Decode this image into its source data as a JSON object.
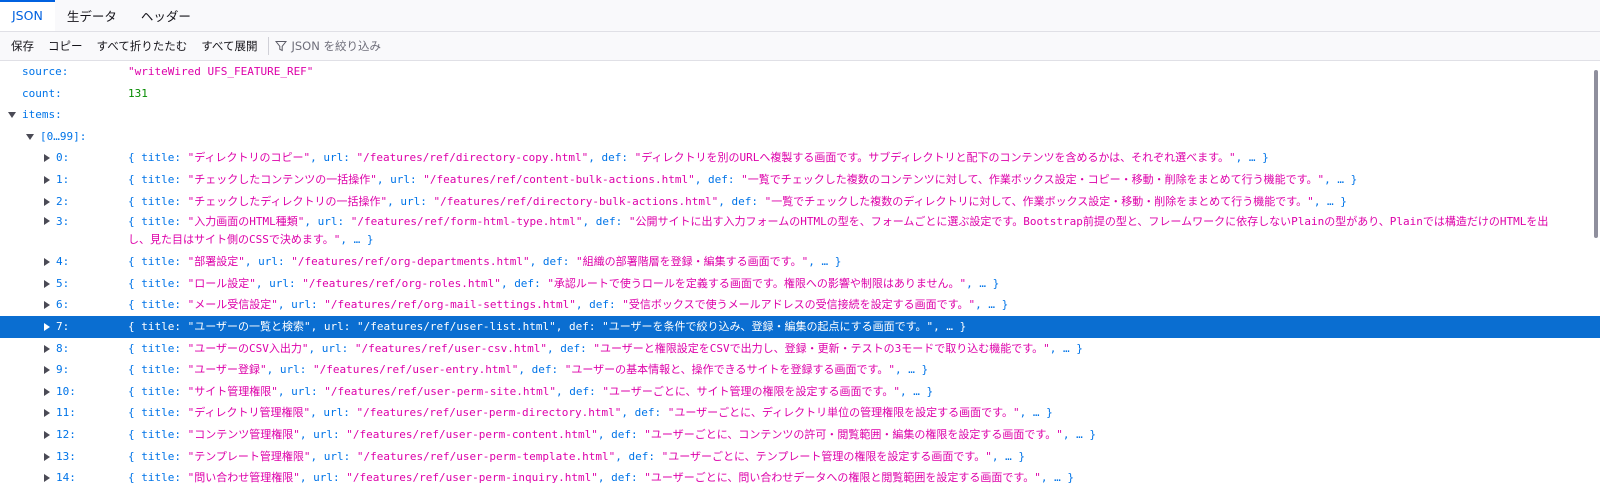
{
  "tabs": [
    {
      "label": "JSON",
      "active": true
    },
    {
      "label": "生データ",
      "active": false
    },
    {
      "label": "ヘッダー",
      "active": false
    }
  ],
  "toolbar": {
    "save": "保存",
    "copy": "コピー",
    "collapse_all": "すべて折りたたむ",
    "expand_all": "すべて展開",
    "filter_placeholder": "JSON を絞り込み",
    "filter_icon": "funnel-icon"
  },
  "colors": {
    "accent": "#0061e0",
    "string": "#dd00a9",
    "number": "#058b00",
    "key": "#0074e8",
    "selected": "#0a6ed1"
  },
  "json": {
    "source_key": "source:",
    "source_value": "\"writeWired UFS_FEATURE_REF\"",
    "count_key": "count:",
    "count_value": "131",
    "items_key": "items:",
    "range_key": "[0…99]:",
    "items": [
      {
        "index": "0:",
        "title": "\"ディレクトリのコピー\"",
        "url": "\"/features/ref/directory-copy.html\"",
        "def": "\"ディレクトリを別のURLへ複製する画面です。サブディレクトリと配下のコンテンツを含めるかは、それぞれ選べます。\""
      },
      {
        "index": "1:",
        "title": "\"チェックしたコンテンツの一括操作\"",
        "url": "\"/features/ref/content-bulk-actions.html\"",
        "def": "\"一覧でチェックした複数のコンテンツに対して、作業ボックス設定・コピー・移動・削除をまとめて行う機能です。\""
      },
      {
        "index": "2:",
        "title": "\"チェックしたディレクトリの一括操作\"",
        "url": "\"/features/ref/directory-bulk-actions.html\"",
        "def": "\"一覧でチェックした複数のディレクトリに対して、作業ボックス設定・移動・削除をまとめて行う機能です。\""
      },
      {
        "index": "3:",
        "title": "\"入力画面のHTML種類\"",
        "url": "\"/features/ref/form-html-type.html\"",
        "def": "\"公開サイトに出す入力フォームのHTMLの型を、フォームごとに選ぶ設定です。Bootstrap前提の型と、フレームワークに依存しないPlainの型があり、Plainでは構造だけのHTMLを出し、見た目はサイト側のCSSで決めます。\""
      },
      {
        "index": "4:",
        "title": "\"部署設定\"",
        "url": "\"/features/ref/org-departments.html\"",
        "def": "\"組織の部署階層を登録・編集する画面です。\""
      },
      {
        "index": "5:",
        "title": "\"ロール設定\"",
        "url": "\"/features/ref/org-roles.html\"",
        "def": "\"承認ルートで使うロールを定義する画面です。権限への影響や制限はありません。\""
      },
      {
        "index": "6:",
        "title": "\"メール受信設定\"",
        "url": "\"/features/ref/org-mail-settings.html\"",
        "def": "\"受信ボックスで使うメールアドレスの受信接続を設定する画面です。\""
      },
      {
        "index": "7:",
        "title": "\"ユーザーの一覧と検索\"",
        "url": "\"/features/ref/user-list.html\"",
        "def": "\"ユーザーを条件で絞り込み、登録・編集の起点にする画面です。\""
      },
      {
        "index": "8:",
        "title": "\"ユーザーのCSV入出力\"",
        "url": "\"/features/ref/user-csv.html\"",
        "def": "\"ユーザーと権限設定をCSVで出力し、登録・更新・テストの3モードで取り込む機能です。\""
      },
      {
        "index": "9:",
        "title": "\"ユーザー登録\"",
        "url": "\"/features/ref/user-entry.html\"",
        "def": "\"ユーザーの基本情報と、操作できるサイトを登録する画面です。\""
      },
      {
        "index": "10:",
        "title": "\"サイト管理権限\"",
        "url": "\"/features/ref/user-perm-site.html\"",
        "def": "\"ユーザーごとに、サイト管理の権限を設定する画面です。\""
      },
      {
        "index": "11:",
        "title": "\"ディレクトリ管理権限\"",
        "url": "\"/features/ref/user-perm-directory.html\"",
        "def": "\"ユーザーごとに、ディレクトリ単位の管理権限を設定する画面です。\""
      },
      {
        "index": "12:",
        "title": "\"コンテンツ管理権限\"",
        "url": "\"/features/ref/user-perm-content.html\"",
        "def": "\"ユーザーごとに、コンテンツの許可・閲覧範囲・編集の権限を設定する画面です。\""
      },
      {
        "index": "13:",
        "title": "\"テンプレート管理権限\"",
        "url": "\"/features/ref/user-perm-template.html\"",
        "def": "\"ユーザーごとに、テンプレート管理の権限を設定する画面です。\""
      },
      {
        "index": "14:",
        "title": "\"問い合わせ管理権限\"",
        "url": "\"/features/ref/user-perm-inquiry.html\"",
        "def": "\"ユーザーごとに、問い合わせデータへの権限と閲覧範囲を設定する画面です。\""
      }
    ],
    "selected_index": 7
  }
}
